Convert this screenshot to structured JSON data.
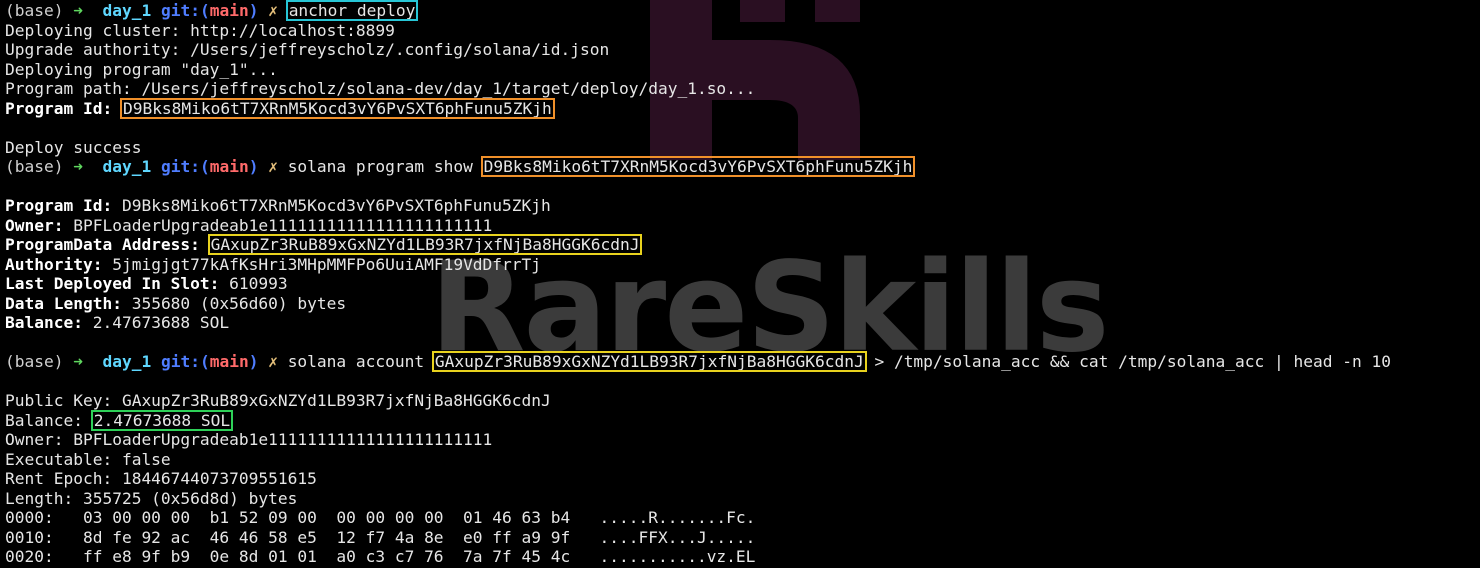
{
  "watermark": {
    "text": "RareSkills"
  },
  "prompt": {
    "env": "(base)",
    "arrow": "➜",
    "dir": "day_1",
    "git": "git:(",
    "branch": "main",
    "git_close": ")",
    "dirty": "✗"
  },
  "cmd1": "anchor deploy",
  "deploy": {
    "cluster": "Deploying cluster: http://localhost:8899",
    "authority": "Upgrade authority: /Users/jeffreyscholz/.config/solana/id.json",
    "deploying": "Deploying program \"day_1\"...",
    "path": "Program path: /Users/jeffreyscholz/solana-dev/day_1/target/deploy/day_1.so...",
    "program_id_label": "Program Id:",
    "program_id": "D9Bks8Miko6tT7XRnM5Kocd3vY6PvSXT6phFunu5ZKjh",
    "success": "Deploy success"
  },
  "cmd2": {
    "text": "solana program show",
    "arg": "D9Bks8Miko6tT7XRnM5Kocd3vY6PvSXT6phFunu5ZKjh"
  },
  "show": {
    "program_id_label": "Program Id:",
    "program_id": "D9Bks8Miko6tT7XRnM5Kocd3vY6PvSXT6phFunu5ZKjh",
    "owner_label": "Owner:",
    "owner": "BPFLoaderUpgradeab1e11111111111111111111111",
    "pda_label": "ProgramData Address:",
    "pda": "GAxupZr3RuB89xGxNZYd1LB93R7jxfNjBa8HGGK6cdnJ",
    "authority_label": "Authority:",
    "authority": "5jmigjgt77kAfKsHri3MHpMMFPo6UuiAMF19VdDfrrTj",
    "slot_label": "Last Deployed In Slot:",
    "slot": "610993",
    "length_label": "Data Length:",
    "length": "355680 (0x56d60) bytes",
    "balance_label": "Balance:",
    "balance": "2.47673688 SOL"
  },
  "cmd3": {
    "text": "solana account",
    "arg": "GAxupZr3RuB89xGxNZYd1LB93R7jxfNjBa8HGGK6cdnJ",
    "rest": "> /tmp/solana_acc && cat /tmp/solana_acc | head -n 10"
  },
  "account": {
    "pubkey": "Public Key: GAxupZr3RuB89xGxNZYd1LB93R7jxfNjBa8HGGK6cdnJ",
    "balance_label": "Balance:",
    "balance": "2.47673688 SOL",
    "owner": "Owner: BPFLoaderUpgradeab1e11111111111111111111111",
    "executable": "Executable: false",
    "rent": "Rent Epoch: 18446744073709551615",
    "length": "Length: 355725 (0x56d8d) bytes",
    "hex": [
      "0000:   03 00 00 00  b1 52 09 00  00 00 00 00  01 46 63 b4   .....R.......Fc.",
      "0010:   8d fe 92 ac  46 46 58 e5  12 f7 4a 8e  e0 ff a9 9f   ....FFX...J.....",
      "0020:   ff e8 9f b9  0e 8d 01 01  a0 c3 c7 76  7a 7f 45 4c   ...........vz.EL"
    ]
  },
  "colors": {
    "cyan_box": "#27c6d6",
    "orange_box": "#f0902a",
    "yellow_box": "#e8d21e",
    "green_box": "#2ed158"
  }
}
